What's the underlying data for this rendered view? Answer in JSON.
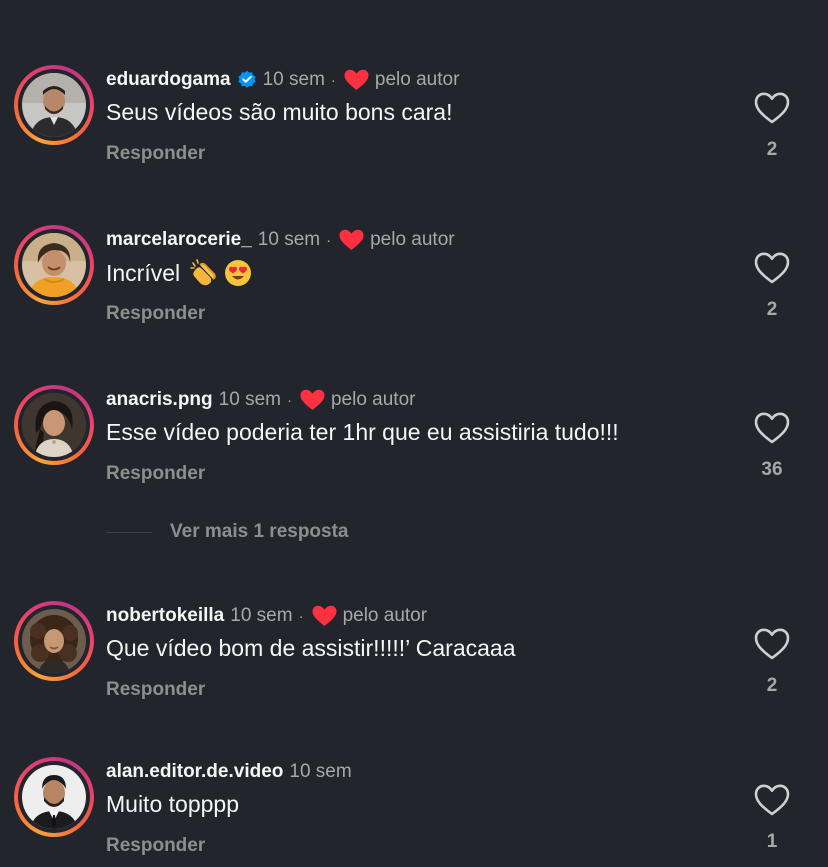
{
  "colors": {
    "background": "#22252b",
    "text": "#f5f5f5",
    "muted": "#a8a8a8",
    "reply": "#8e8e8e",
    "heart": "#ff3040",
    "verified": "#0095f6"
  },
  "comments": [
    {
      "username": "eduardogama",
      "verified": true,
      "time": "10 sem",
      "dot": "·",
      "liked_by_author": true,
      "author_label": "pelo autor",
      "text": "Seus vídeos são muito bons cara!",
      "reply_label": "Responder",
      "likes": "2"
    },
    {
      "username": "marcelarocerie_",
      "verified": false,
      "time": "10 sem",
      "dot": "·",
      "liked_by_author": true,
      "author_label": "pelo autor",
      "text": "Incrível",
      "emojis": [
        "clapping-hands-emoji",
        "heart-eyes-emoji"
      ],
      "reply_label": "Responder",
      "likes": "2"
    },
    {
      "username": "anacris.png",
      "verified": false,
      "time": "10 sem",
      "dot": "·",
      "liked_by_author": true,
      "author_label": "pelo autor",
      "text": "Esse vídeo poderia ter 1hr que eu assistiria tudo!!!",
      "reply_label": "Responder",
      "likes": "36",
      "more_replies": "Ver mais 1 resposta"
    },
    {
      "username": "nobertokeilla",
      "verified": false,
      "time": "10 sem",
      "dot": "·",
      "liked_by_author": true,
      "author_label": "pelo autor",
      "text": "Que vídeo bom de assistir!!!!!’ Caracaaa",
      "reply_label": "Responder",
      "likes": "2"
    },
    {
      "username": "alan.editor.de.video",
      "verified": false,
      "time": "10 sem",
      "liked_by_author": false,
      "text": "Muito topppp",
      "reply_label": "Responder",
      "likes": "1"
    }
  ]
}
